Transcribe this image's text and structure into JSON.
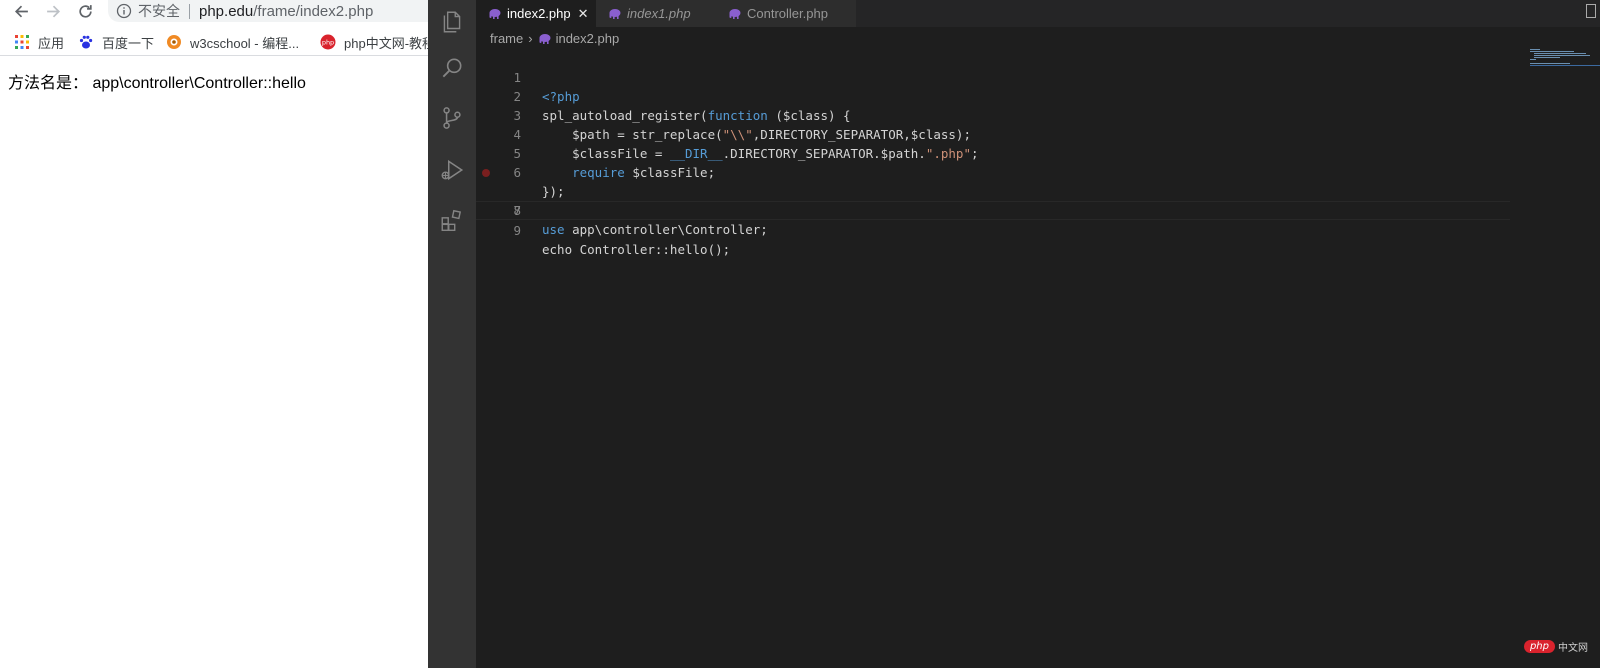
{
  "browser": {
    "omnibox": {
      "security_label": "不安全",
      "host": "php.edu",
      "path": "/frame/index2.php"
    },
    "bookmarks": [
      {
        "label": "应用",
        "icon": "apps-grid-icon"
      },
      {
        "label": "百度一下",
        "icon": "baidu-paw-icon"
      },
      {
        "label": "w3cschool - 编程...",
        "icon": "w3cschool-icon"
      },
      {
        "label": "php中文网-教程",
        "icon": "php-cn-icon"
      }
    ],
    "page_text": "方法名是： app\\controller\\Controller::hello"
  },
  "editor": {
    "tabs": [
      {
        "label": "index2.php",
        "active": true,
        "italic": false
      },
      {
        "label": "index1.php",
        "active": false,
        "italic": true
      },
      {
        "label": "Controller.php",
        "active": false,
        "italic": false
      }
    ],
    "breadcrumb": {
      "folder": "frame",
      "file": "index2.php"
    },
    "line_numbers": [
      "1",
      "2",
      "3",
      "4",
      "5",
      "6",
      "7",
      "8",
      "9"
    ],
    "code": {
      "l1_tag": "<?php",
      "l2_a": "spl_autoload_register(",
      "l2_kw": "function",
      "l2_b": " ($class) {",
      "l3_a": "    $path = str_replace(",
      "l3_str": "\"\\\\\"",
      "l3_b": ",DIRECTORY_SEPARATOR,$class);",
      "l4_a": "    $classFile = ",
      "l4_kw": "__DIR__",
      "l4_b": ".DIRECTORY_SEPARATOR.$path.",
      "l4_str": "\".php\"",
      "l4_c": ";",
      "l5_kw": "    require",
      "l5_b": " $classFile;",
      "l6": "});",
      "l8_kw": "use",
      "l8_b": " app\\controller\\Controller;",
      "l9": "echo Controller::hello();"
    }
  },
  "watermark": {
    "logo": "php",
    "text": "中文网"
  },
  "colors": {
    "editor_bg": "#1e1e1e",
    "activity_bar": "#333333",
    "keyword_blue": "#569cd6",
    "string_orange": "#ce9178",
    "php_elephant": "#8a5fcf"
  }
}
